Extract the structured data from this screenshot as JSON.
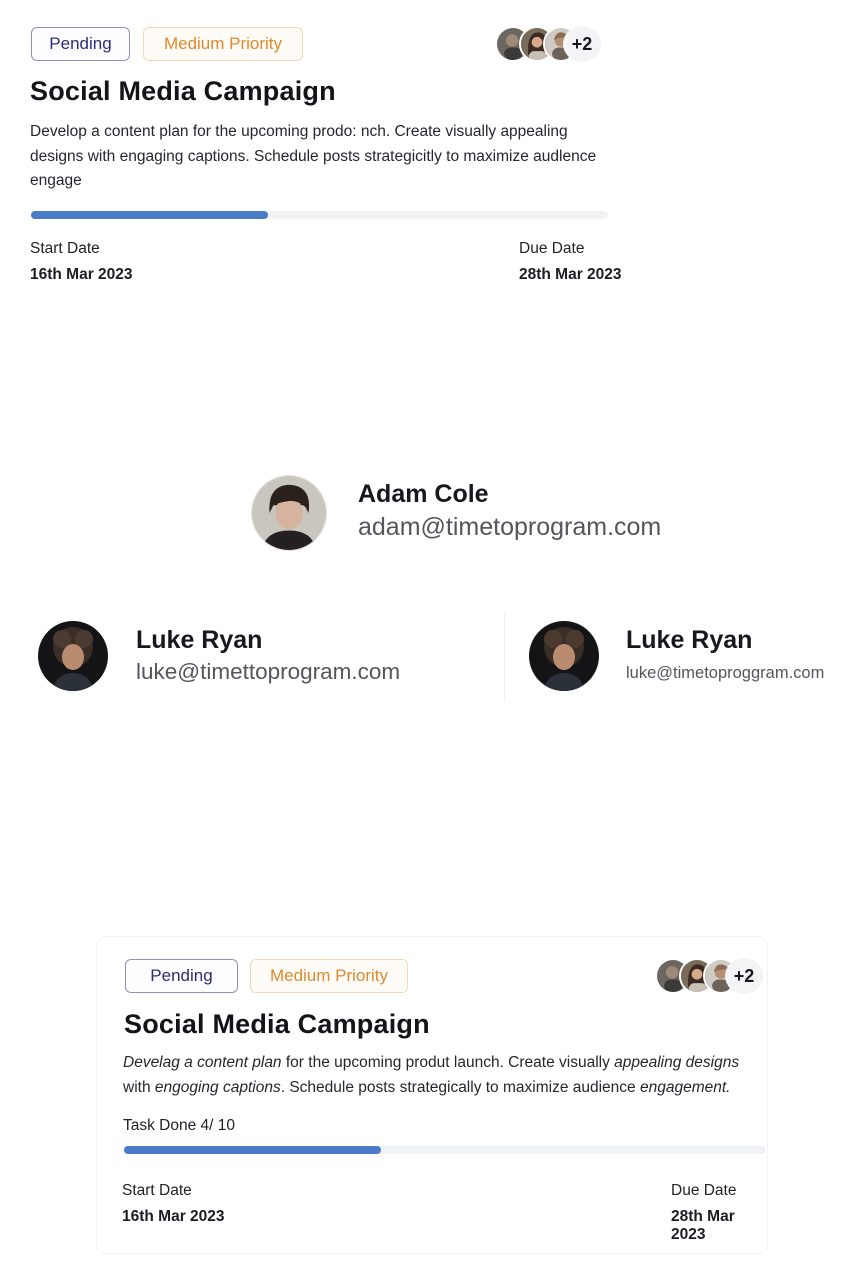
{
  "card_top": {
    "status_badge": "Pending",
    "priority_badge": "Medium Priority",
    "avatar_overflow": "+2",
    "title": "Social Media Campaign",
    "description": "Develop a content plan for the upcoming prodo: nch. Create visually appealing designs with engaging captions. Schedule posts strategicitly to maximize audlence engage",
    "progress_fraction": 0.41,
    "start_label": "Start Date",
    "start_value": "16th Mar 2023",
    "due_label": "Due Date",
    "due_value": "28th Mar 2023"
  },
  "user_main": {
    "name": "Adam Cole",
    "email": "adam@timetoprogram.com"
  },
  "user_left": {
    "name": "Luke Ryan",
    "email": "luke@timettoprogram.com"
  },
  "user_right": {
    "name": "Luke Ryan",
    "email": "luke@timetoproggram.com"
  },
  "card_bottom": {
    "status_badge": "Pending",
    "priority_badge": "Medium Priority",
    "avatar_overflow": "+2",
    "title": "Social Media Campaign",
    "desc_parts": {
      "p1": "Develag a content plan",
      "p2": " for the upcoming produt launch. Create visually ",
      "p3": "appealing designs",
      "p4": " with ",
      "p5": "engoging captions",
      "p6": ". Schedule posts strategically to maximize audience ",
      "p7": "engagement."
    },
    "task_done": "Task Done 4/ 10",
    "progress_fraction": 0.4,
    "start_label": "Start Date",
    "start_value": "16th Mar 2023",
    "due_label": "Due Date",
    "due_value": "28th Mar 2023"
  },
  "colors": {
    "accent": "#4a7bc9",
    "pending_text": "#2b2d78",
    "priority_text": "#e0892d"
  }
}
